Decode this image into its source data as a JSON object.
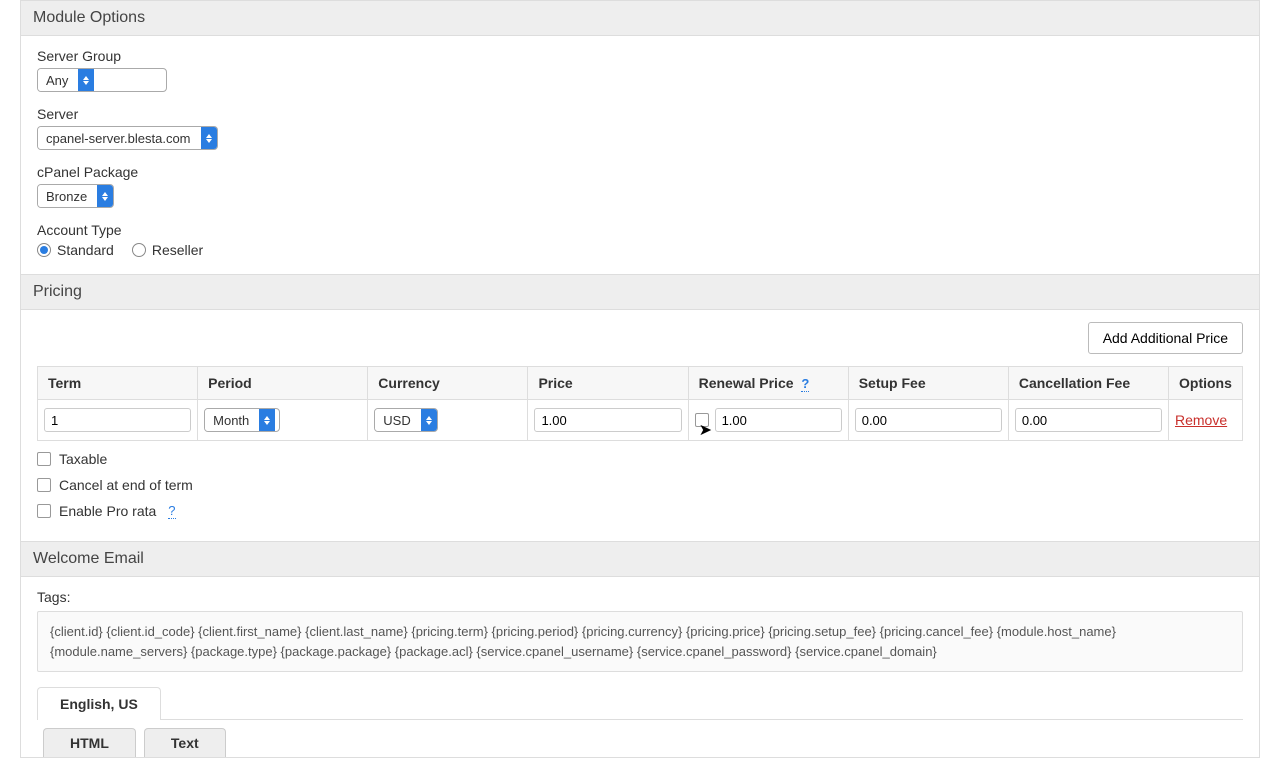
{
  "moduleOptions": {
    "heading": "Module Options",
    "serverGroup": {
      "label": "Server Group",
      "value": "Any"
    },
    "server": {
      "label": "Server",
      "value": "cpanel-server.blesta.com"
    },
    "cpanelPackage": {
      "label": "cPanel Package",
      "value": "Bronze"
    },
    "accountType": {
      "label": "Account Type",
      "standard": "Standard",
      "reseller": "Reseller",
      "selected": "standard"
    }
  },
  "pricing": {
    "heading": "Pricing",
    "addButton": "Add Additional Price",
    "headers": {
      "term": "Term",
      "period": "Period",
      "currency": "Currency",
      "price": "Price",
      "renewalPrice": "Renewal Price",
      "setupFee": "Setup Fee",
      "cancellationFee": "Cancellation Fee",
      "options": "Options"
    },
    "row": {
      "term": "1",
      "period": "Month",
      "currency": "USD",
      "price": "1.00",
      "renewalPrice": "1.00",
      "setupFee": "0.00",
      "cancellationFee": "0.00",
      "remove": "Remove"
    },
    "helpIcon": "?",
    "checkboxes": {
      "taxable": "Taxable",
      "cancelEndTerm": "Cancel at end of term",
      "enableProRata": "Enable Pro rata"
    }
  },
  "welcomeEmail": {
    "heading": "Welcome Email",
    "tagsLabel": "Tags:",
    "tagsContent": "{client.id} {client.id_code} {client.first_name} {client.last_name} {pricing.term} {pricing.period} {pricing.currency} {pricing.price} {pricing.setup_fee} {pricing.cancel_fee} {module.host_name} {module.name_servers} {package.type} {package.package} {package.acl} {service.cpanel_username} {service.cpanel_password} {service.cpanel_domain}",
    "langTab": "English, US",
    "htmlTab": "HTML",
    "textTab": "Text"
  }
}
